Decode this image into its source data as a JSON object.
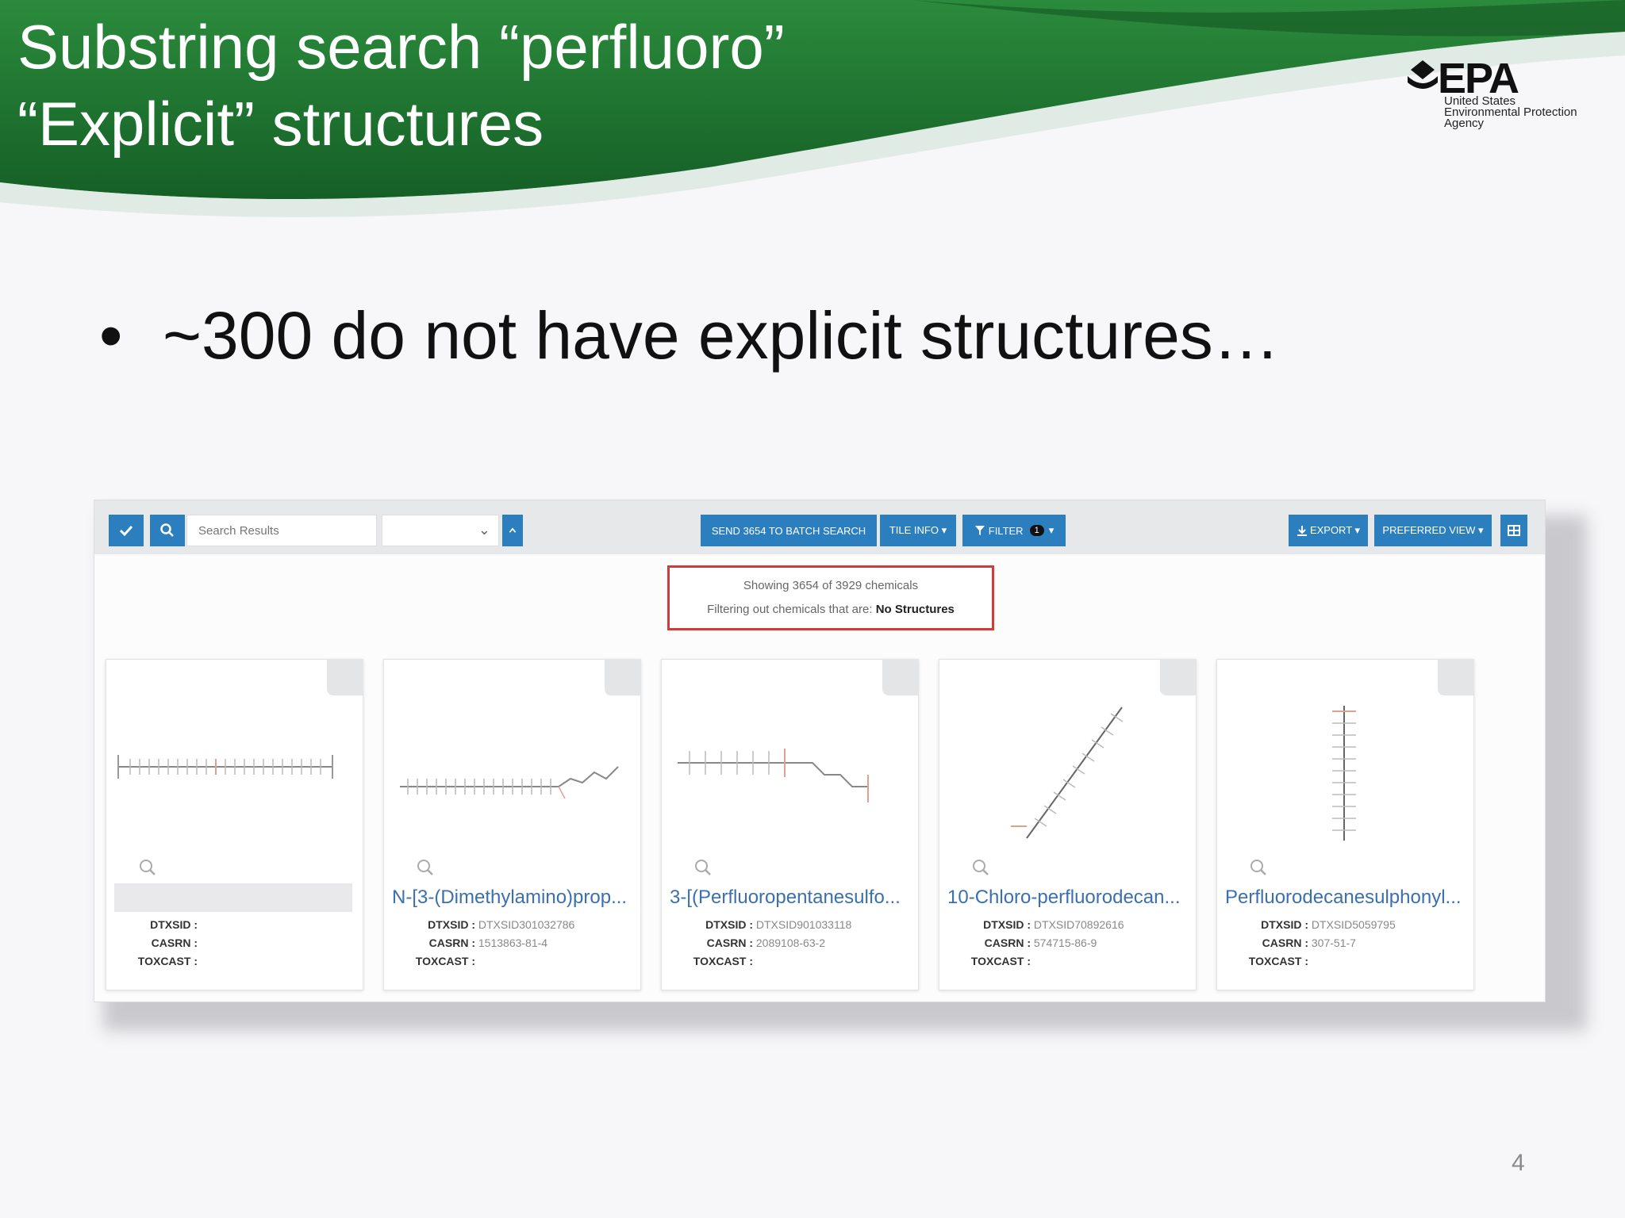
{
  "slide": {
    "title_line1": "Substring search “perfluoro”",
    "title_line2": "“Explicit” structures",
    "bullet": "~300 do not have explicit structures…",
    "page_number": "4"
  },
  "logo": {
    "word": "EPA",
    "line1": "United States",
    "line2": "Environmental Protection",
    "line3": "Agency"
  },
  "toolbar": {
    "search_placeholder": "Search Results",
    "batch_label": "SEND 3654 TO BATCH SEARCH",
    "tile_info_label": "TILE INFO ▾",
    "filter_label": "FILTER",
    "filter_count": "1",
    "export_label": "EXPORT ▾",
    "preferred_view_label": "PREFERRED VIEW ▾"
  },
  "status": {
    "line1": "Showing 3654 of 3929 chemicals",
    "line2_prefix": "Filtering out chemicals that are:",
    "line2_value": "No Structures"
  },
  "meta_labels": {
    "dtxsid": "DTXSID :",
    "casrn": "CASRN :",
    "toxcast": "TOXCAST :"
  },
  "cards": [
    {
      "name": "",
      "dtxsid": "",
      "casrn": ""
    },
    {
      "name": "N-[3-(Dimethylamino)prop...",
      "dtxsid": "DTXSID301032786",
      "casrn": "1513863-81-4"
    },
    {
      "name": "3-[(Perfluoropentanesulfo...",
      "dtxsid": "DTXSID901033118",
      "casrn": "2089108-63-2"
    },
    {
      "name": "10-Chloro-perfluorodecan...",
      "dtxsid": "DTXSID70892616",
      "casrn": "574715-86-9"
    },
    {
      "name": "Perfluorodecanesulphonyl...",
      "dtxsid": "DTXSID5059795",
      "casrn": "307-51-7"
    }
  ],
  "colors": {
    "banner_green": "#1f7a34",
    "button_blue": "#2c7fbf",
    "link_blue": "#3a6fb0",
    "highlight_red": "#d33b3b"
  }
}
